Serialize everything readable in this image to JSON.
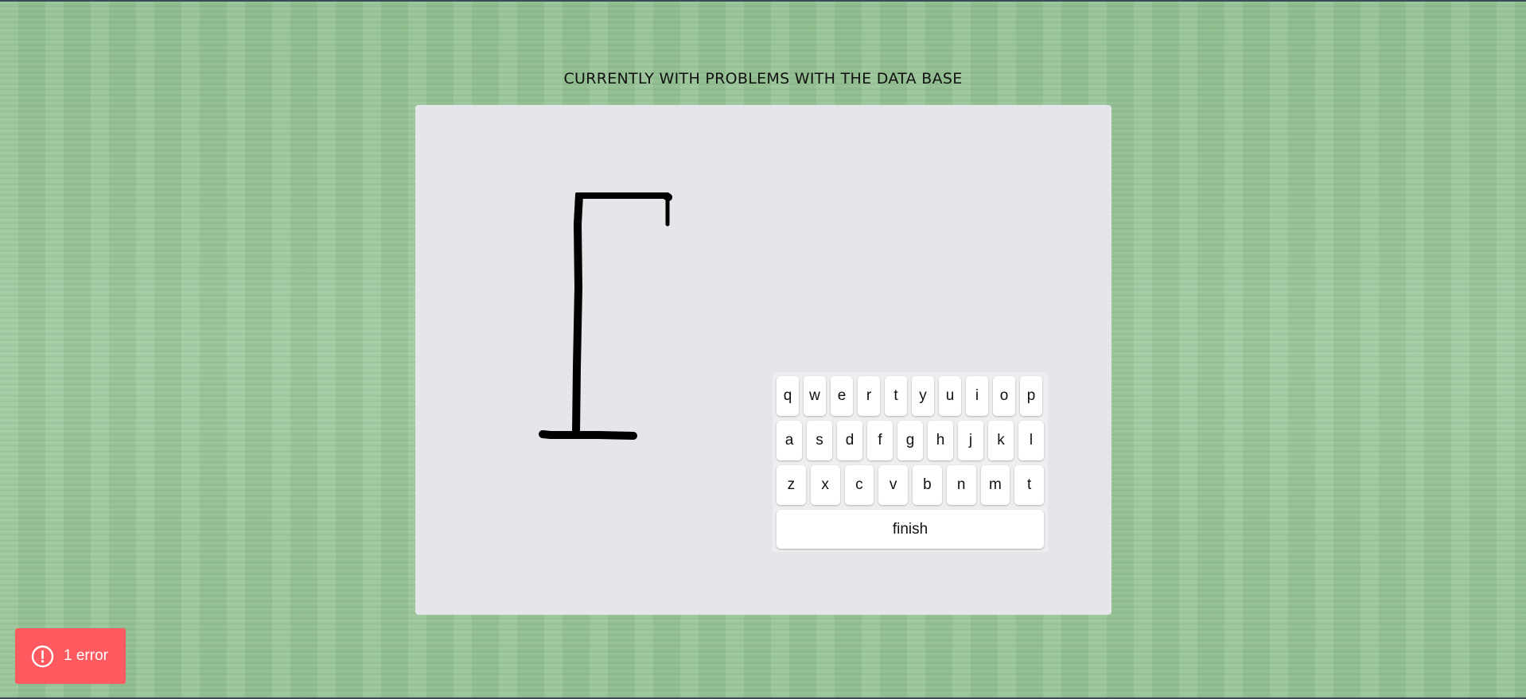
{
  "notice": "CURRENTLY WITH PROBLEMS WITH THE DATA BASE",
  "keyboard": {
    "row1": [
      "q",
      "w",
      "e",
      "r",
      "t",
      "y",
      "u",
      "i",
      "o",
      "p"
    ],
    "row2": [
      "a",
      "s",
      "d",
      "f",
      "g",
      "h",
      "j",
      "k",
      "l"
    ],
    "row3": [
      "z",
      "x",
      "c",
      "v",
      "b",
      "n",
      "m",
      "t"
    ],
    "finish_label": "finish"
  },
  "error_toast": {
    "label": "1 error",
    "icon": "alert-circle-icon",
    "color": "#ff5a5f"
  },
  "gallows": {
    "icon": "hangman-gallows"
  }
}
